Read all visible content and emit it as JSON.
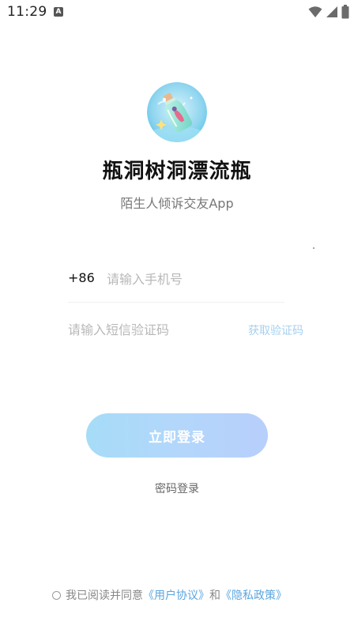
{
  "status_bar": {
    "time": "11:29",
    "notification_icon": "A"
  },
  "app": {
    "title": "瓶洞树洞漂流瓶",
    "subtitle": "陌生人倾诉交友App",
    "logo_icon": "drift-bottle-logo"
  },
  "form": {
    "country_code": "+86",
    "phone_placeholder": "请输入手机号",
    "code_placeholder": "请输入短信验证码",
    "get_code_label": "获取验证码"
  },
  "actions": {
    "login_label": "立即登录",
    "password_login_label": "密码登录"
  },
  "agreement": {
    "prefix": "我已阅读并同意",
    "user_agreement": "《用户协议》",
    "conjunction": "和",
    "privacy_policy": "《隐私政策》"
  },
  "colors": {
    "link": "#5aa6e0",
    "button_gradient_start": "#a6dcf7",
    "button_gradient_end": "#b7cffb",
    "get_code": "#a6d0ef"
  }
}
